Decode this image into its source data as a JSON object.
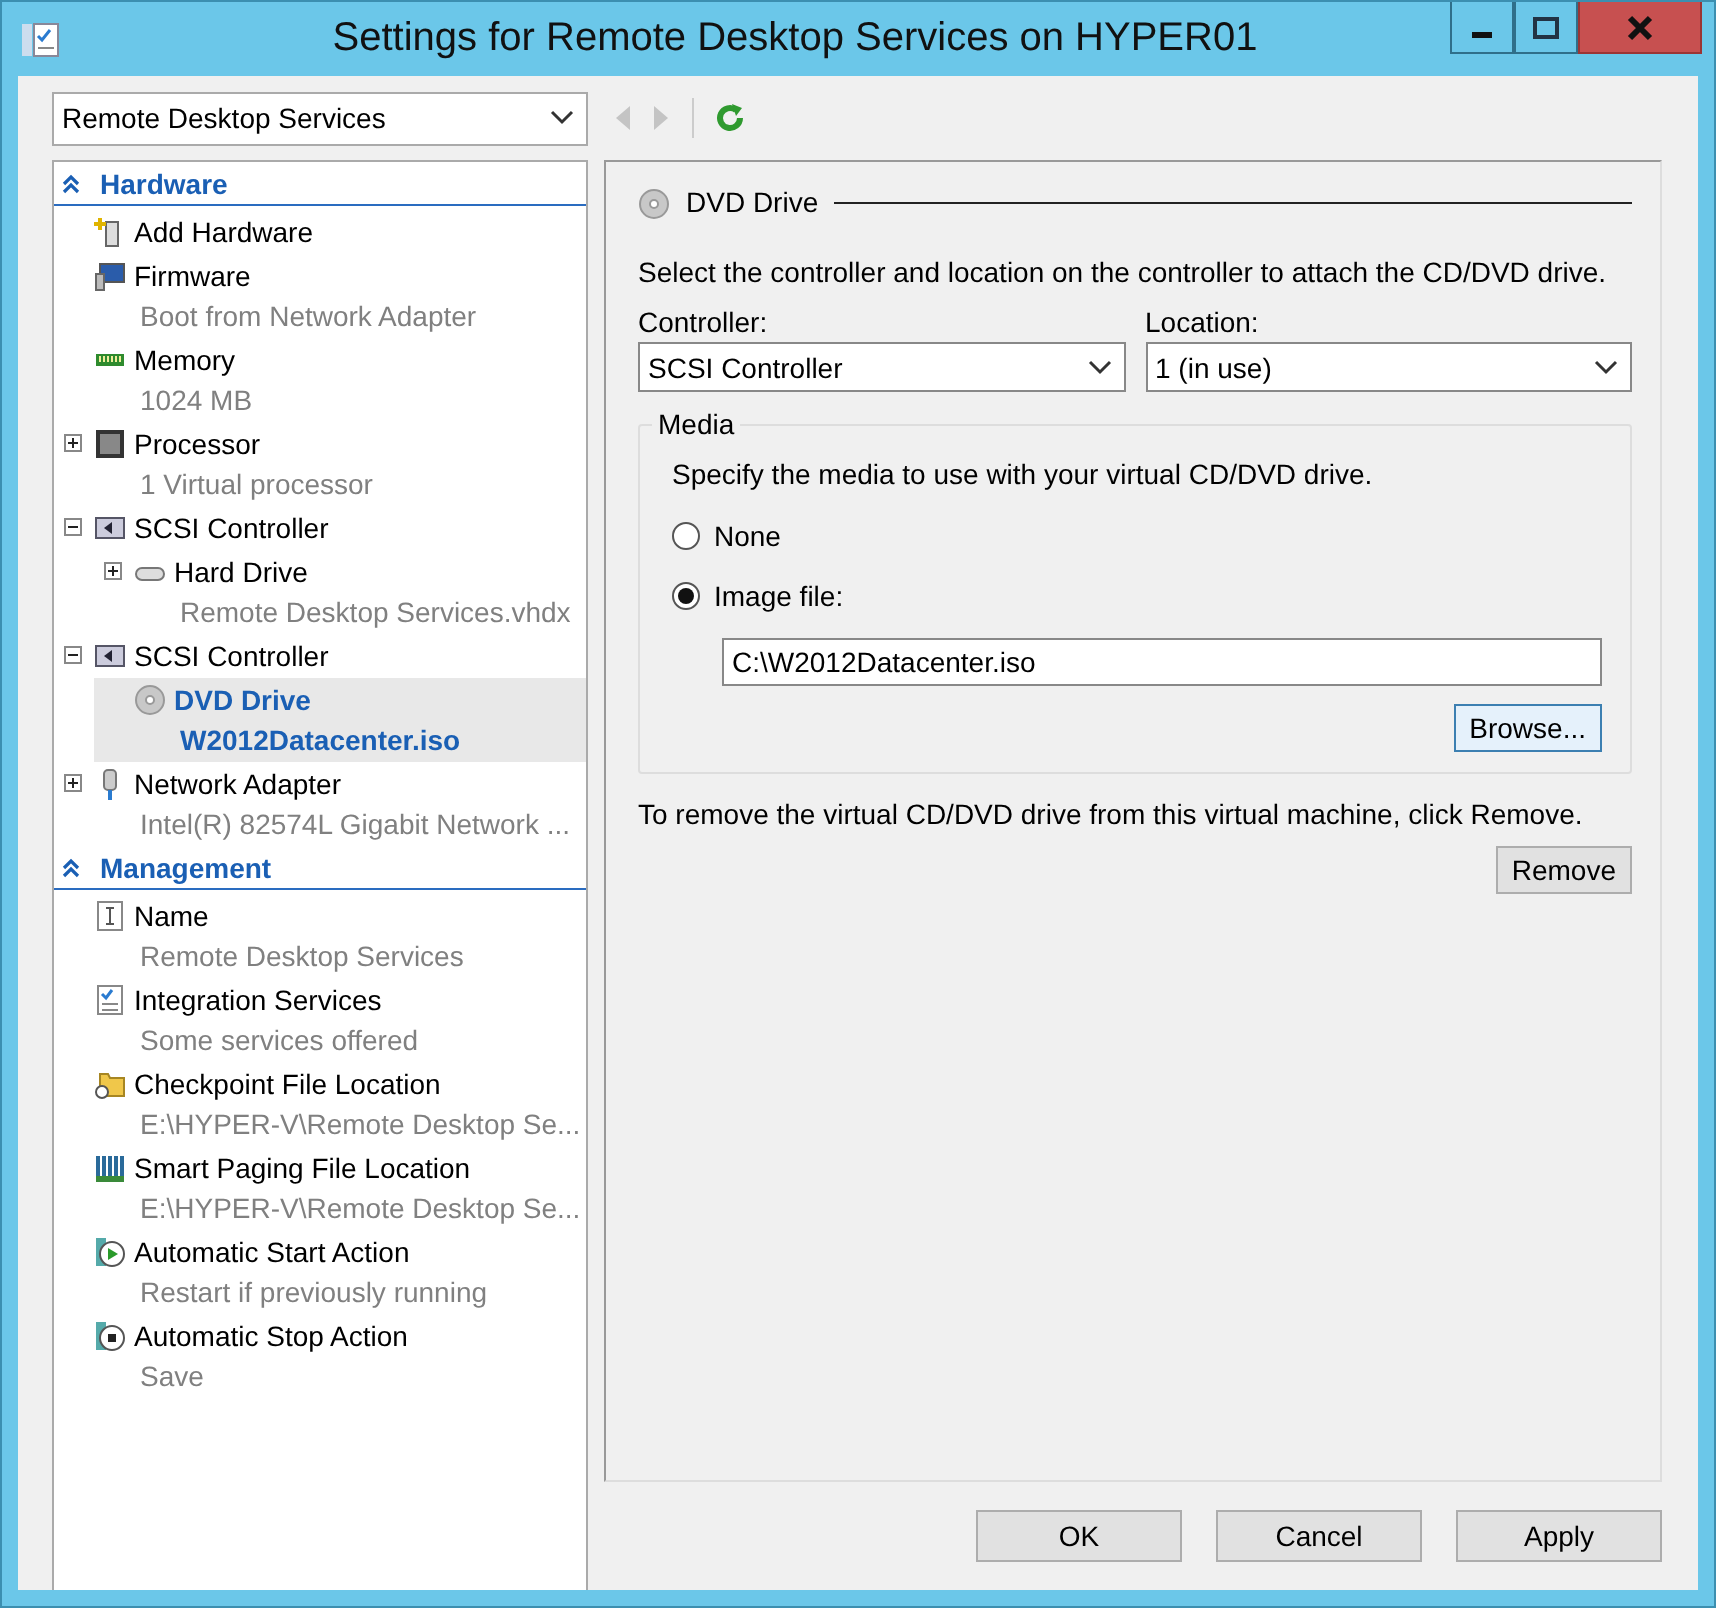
{
  "window": {
    "title": "Settings for Remote Desktop Services on HYPER01"
  },
  "vm_selector": {
    "value": "Remote Desktop Services"
  },
  "toolbar": {
    "back_disabled": true,
    "forward_disabled": true
  },
  "sections": [
    {
      "title": "Hardware",
      "expanded": true,
      "items": [
        {
          "kind": "add",
          "label": "Add Hardware",
          "selected": false
        },
        {
          "kind": "firmware",
          "label": "Firmware",
          "detail": "Boot from Network Adapter",
          "selected": false
        },
        {
          "kind": "memory",
          "label": "Memory",
          "detail": "1024 MB",
          "selected": false
        },
        {
          "kind": "processor",
          "label": "Processor",
          "detail": "1 Virtual processor",
          "expanded": false,
          "selected": false
        },
        {
          "kind": "controller",
          "label": "SCSI Controller",
          "expanded": true,
          "selected": false,
          "children": [
            {
              "kind": "disk",
              "label": "Hard Drive",
              "detail": "Remote Desktop Services.vhdx",
              "expanded": false,
              "selected": false
            }
          ]
        },
        {
          "kind": "controller",
          "label": "SCSI Controller",
          "expanded": true,
          "selected": false,
          "children": [
            {
              "kind": "dvd",
              "label": "DVD Drive",
              "detail": "W2012Datacenter.iso",
              "selected": true
            }
          ]
        },
        {
          "kind": "network",
          "label": "Network Adapter",
          "detail": "Intel(R) 82574L Gigabit Network ...",
          "expanded": false,
          "selected": false
        }
      ]
    },
    {
      "title": "Management",
      "expanded": true,
      "items": [
        {
          "kind": "name",
          "label": "Name",
          "detail": "Remote Desktop Services",
          "selected": false
        },
        {
          "kind": "integration",
          "label": "Integration Services",
          "detail": "Some services offered",
          "selected": false
        },
        {
          "kind": "checkpoint",
          "label": "Checkpoint File Location",
          "detail": "E:\\HYPER-V\\Remote Desktop Se...",
          "selected": false
        },
        {
          "kind": "paging",
          "label": "Smart Paging File Location",
          "detail": "E:\\HYPER-V\\Remote Desktop Se...",
          "selected": false
        },
        {
          "kind": "start",
          "label": "Automatic Start Action",
          "detail": "Restart if previously running",
          "selected": false
        },
        {
          "kind": "stop",
          "label": "Automatic Stop Action",
          "detail": "Save",
          "selected": false
        }
      ]
    }
  ],
  "detail": {
    "heading": "DVD Drive",
    "intro": "Select the controller and location on the controller to attach the CD/DVD drive.",
    "controller": {
      "label": "Controller:",
      "value": "SCSI Controller"
    },
    "location": {
      "label": "Location:",
      "value": "1 (in use)"
    },
    "media": {
      "title": "Media",
      "intro": "Specify the media to use with your virtual CD/DVD drive.",
      "options": [
        {
          "label": "None",
          "selected": false
        },
        {
          "label": "Image file:",
          "selected": true
        }
      ],
      "path": "C:\\W2012Datacenter.iso",
      "browse": "Browse..."
    },
    "remove_note": "To remove the virtual CD/DVD drive from this virtual machine, click Remove.",
    "remove": "Remove"
  },
  "buttons": [
    "OK",
    "Cancel",
    "Apply"
  ]
}
